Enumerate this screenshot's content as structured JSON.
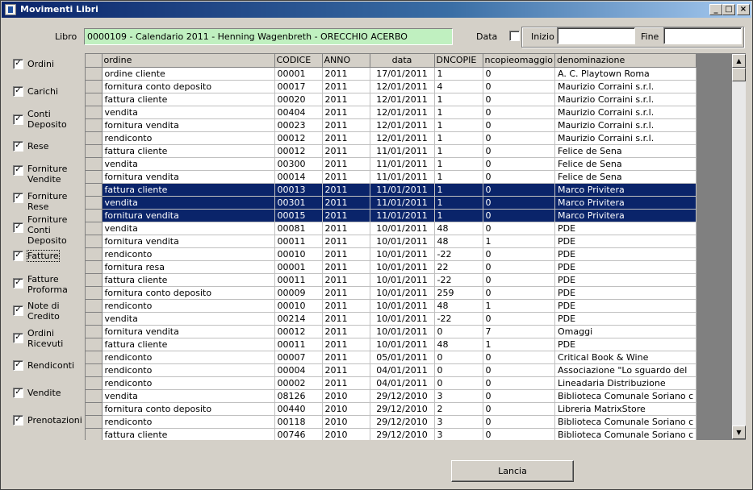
{
  "window": {
    "title": "Movimenti Libri"
  },
  "filters": {
    "libro_label": "Libro",
    "libro_value": "0000109 - Calendario 2011 - Henning Wagenbreth - ORECCHIO ACERBO",
    "data_label": "Data",
    "data_checked": false,
    "inizio_label": "Inizio",
    "inizio_value": "",
    "fine_label": "Fine",
    "fine_value": ""
  },
  "checkboxes": [
    {
      "label": "Ordini",
      "checked": true
    },
    {
      "label": "Carichi",
      "checked": true
    },
    {
      "label": "Conti\nDeposito",
      "checked": true
    },
    {
      "label": "Rese",
      "checked": true
    },
    {
      "label": "Forniture\nVendite",
      "checked": true
    },
    {
      "label": "Forniture\nRese",
      "checked": true
    },
    {
      "label": "Forniture\nConti\nDeposito",
      "checked": true
    },
    {
      "label": "Fatture",
      "checked": true
    },
    {
      "label": "Fatture\nProforma",
      "checked": true
    },
    {
      "label": "Note di\nCredito",
      "checked": true
    },
    {
      "label": "Ordini\nRicevuti",
      "checked": true
    },
    {
      "label": "Rendiconti",
      "checked": true
    },
    {
      "label": "Vendite",
      "checked": true
    },
    {
      "label": "Prenotazioni",
      "checked": true
    }
  ],
  "grid": {
    "columns": [
      "ordine",
      "CODICE",
      "ANNO",
      "data",
      "DNCOPIE",
      "ncopieomaggio",
      "denominazione"
    ],
    "rows": [
      [
        "ordine cliente",
        "00001",
        "2011",
        "17/01/2011",
        "1",
        "0",
        "A. C. Playtown Roma"
      ],
      [
        "fornitura conto deposito",
        "00017",
        "2011",
        "12/01/2011",
        "4",
        "0",
        "Maurizio Corraini s.r.l."
      ],
      [
        "fattura cliente",
        "00020",
        "2011",
        "12/01/2011",
        "1",
        "0",
        "Maurizio Corraini s.r.l."
      ],
      [
        "vendita",
        "00404",
        "2011",
        "12/01/2011",
        "1",
        "0",
        "Maurizio Corraini s.r.l."
      ],
      [
        "fornitura vendita",
        "00023",
        "2011",
        "12/01/2011",
        "1",
        "0",
        "Maurizio Corraini s.r.l."
      ],
      [
        "rendiconto",
        "00012",
        "2011",
        "12/01/2011",
        "1",
        "0",
        "Maurizio Corraini s.r.l."
      ],
      [
        "fattura cliente",
        "00012",
        "2011",
        "11/01/2011",
        "1",
        "0",
        "Felice de Sena"
      ],
      [
        "vendita",
        "00300",
        "2011",
        "11/01/2011",
        "1",
        "0",
        "Felice de Sena"
      ],
      [
        "fornitura vendita",
        "00014",
        "2011",
        "11/01/2011",
        "1",
        "0",
        "Felice de Sena"
      ],
      [
        "fattura cliente",
        "00013",
        "2011",
        "11/01/2011",
        "1",
        "0",
        "Marco Privitera"
      ],
      [
        "vendita",
        "00301",
        "2011",
        "11/01/2011",
        "1",
        "0",
        "Marco Privitera"
      ],
      [
        "fornitura vendita",
        "00015",
        "2011",
        "11/01/2011",
        "1",
        "0",
        "Marco Privitera"
      ],
      [
        "vendita",
        "00081",
        "2011",
        "10/01/2011",
        "48",
        "0",
        "PDE"
      ],
      [
        "fornitura vendita",
        "00011",
        "2011",
        "10/01/2011",
        "48",
        "1",
        "PDE"
      ],
      [
        "rendiconto",
        "00010",
        "2011",
        "10/01/2011",
        "-22",
        "0",
        "PDE"
      ],
      [
        "fornitura resa",
        "00001",
        "2011",
        "10/01/2011",
        "22",
        "0",
        "PDE"
      ],
      [
        "fattura cliente",
        "00011",
        "2011",
        "10/01/2011",
        "-22",
        "0",
        "PDE"
      ],
      [
        "fornitura conto deposito",
        "00009",
        "2011",
        "10/01/2011",
        "259",
        "0",
        "PDE"
      ],
      [
        "rendiconto",
        "00010",
        "2011",
        "10/01/2011",
        "48",
        "1",
        "PDE"
      ],
      [
        "vendita",
        "00214",
        "2011",
        "10/01/2011",
        "-22",
        "0",
        "PDE"
      ],
      [
        "fornitura vendita",
        "00012",
        "2011",
        "10/01/2011",
        "0",
        "7",
        "Omaggi"
      ],
      [
        "fattura cliente",
        "00011",
        "2011",
        "10/01/2011",
        "48",
        "1",
        "PDE"
      ],
      [
        "rendiconto",
        "00007",
        "2011",
        "05/01/2011",
        "0",
        "0",
        "Critical Book & Wine"
      ],
      [
        "rendiconto",
        "00004",
        "2011",
        "04/01/2011",
        "0",
        "0",
        "Associazione \"Lo sguardo del"
      ],
      [
        "rendiconto",
        "00002",
        "2011",
        "04/01/2011",
        "0",
        "0",
        "Lineadaria Distribuzione"
      ],
      [
        "vendita",
        "08126",
        "2010",
        "29/12/2010",
        "3",
        "0",
        "Biblioteca Comunale Soriano c"
      ],
      [
        "fornitura conto deposito",
        "00440",
        "2010",
        "29/12/2010",
        "2",
        "0",
        "Libreria MatrixStore"
      ],
      [
        "rendiconto",
        "00118",
        "2010",
        "29/12/2010",
        "3",
        "0",
        "Biblioteca Comunale Soriano c"
      ],
      [
        "fattura cliente",
        "00746",
        "2010",
        "29/12/2010",
        "3",
        "0",
        "Biblioteca Comunale Soriano c"
      ]
    ],
    "highlighted_rows": [
      9,
      10,
      11
    ]
  },
  "actions": {
    "lancia_label": "Lancia"
  },
  "colors": {
    "selection": "#0a246a",
    "libro_bg": "#c0f0c0",
    "window_bg": "#d4d0c8"
  }
}
